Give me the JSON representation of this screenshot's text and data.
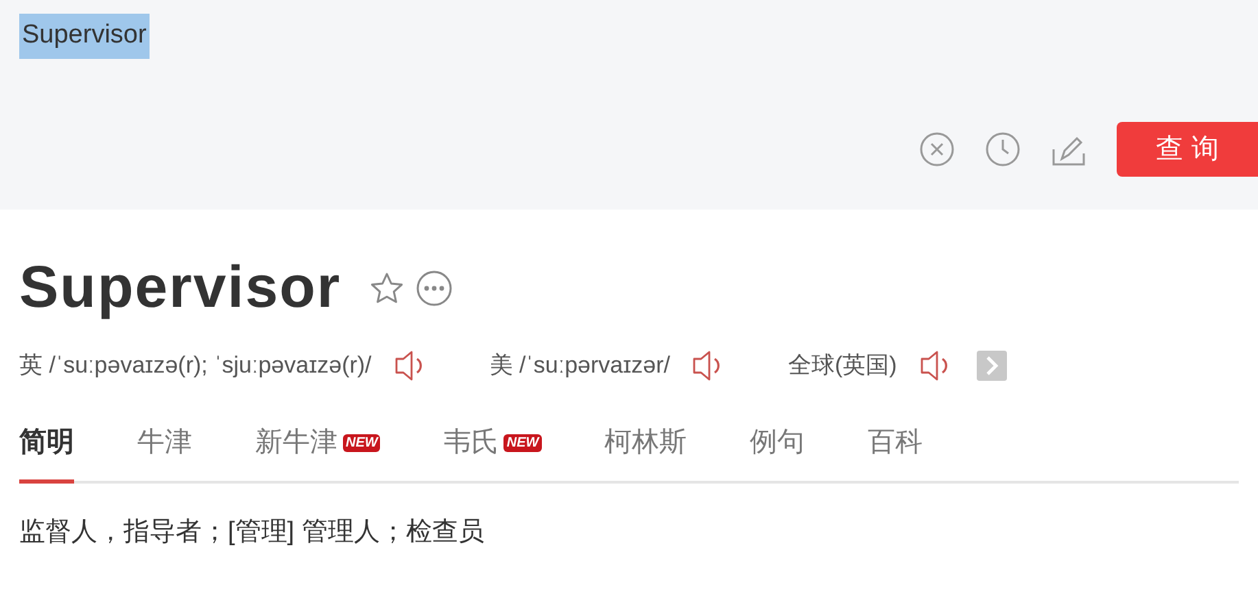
{
  "search": {
    "value": "Supervisor",
    "text_selected": true,
    "button": "查 询"
  },
  "entry": {
    "headword": "Supervisor",
    "favorited": false
  },
  "pronunciations": [
    {
      "label": "英",
      "phonetic": "/ˈsuːpəvaɪzə(r); ˈsjuːpəvaɪzə(r)/"
    },
    {
      "label": "美",
      "phonetic": "/ˈsuːpərvaɪzər/"
    },
    {
      "label": "全球(英国)"
    }
  ],
  "tabs": [
    {
      "label": "简明",
      "selected": true
    },
    {
      "label": "牛津",
      "selected": false
    },
    {
      "label": "新牛津",
      "selected": false,
      "badge": "NEW"
    },
    {
      "label": "韦氏",
      "selected": false,
      "badge": "NEW"
    },
    {
      "label": "柯林斯",
      "selected": false
    },
    {
      "label": "例句",
      "selected": false
    },
    {
      "label": "百科",
      "selected": false
    }
  ],
  "definition": "监督人，指导者；[管理] 管理人；检查员"
}
